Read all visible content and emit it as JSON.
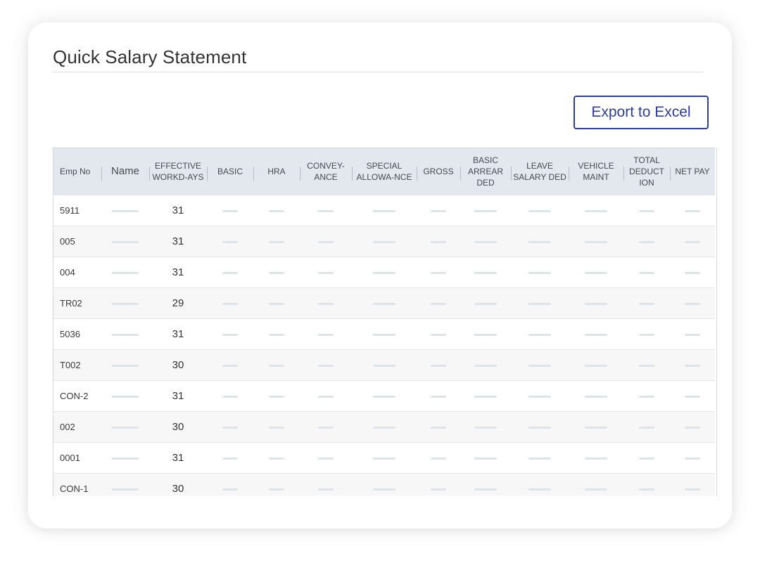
{
  "page": {
    "title": "Quick Salary Statement"
  },
  "toolbar": {
    "export_label": "Export to Excel"
  },
  "colors": {
    "accent": "#2d3f95",
    "header_bg": "#e3e7ee",
    "row_alt_bg": "#f7f7f8",
    "placeholder": "#dfe4ea"
  },
  "table": {
    "columns": [
      "Emp No",
      "Name",
      "EFFECTIVE WORKD-AYS",
      "BASIC",
      "HRA",
      "CONVEY-ANCE",
      "SPECIAL ALLOWA-NCE",
      "GROSS",
      "BASIC ARREAR DED",
      "LEAVE SALARY DED",
      "VEHICLE MAINT",
      "TOTAL DEDUCT ION",
      "NET PAY"
    ],
    "rows": [
      {
        "emp_no": "5911",
        "workdays": "31"
      },
      {
        "emp_no": "005",
        "workdays": "31"
      },
      {
        "emp_no": "004",
        "workdays": "31"
      },
      {
        "emp_no": "TR02",
        "workdays": "29"
      },
      {
        "emp_no": "5036",
        "workdays": "31"
      },
      {
        "emp_no": "T002",
        "workdays": "30"
      },
      {
        "emp_no": "CON-2",
        "workdays": "31"
      },
      {
        "emp_no": "002",
        "workdays": "30"
      },
      {
        "emp_no": "0001",
        "workdays": "31"
      },
      {
        "emp_no": "CON-1",
        "workdays": "30"
      }
    ]
  }
}
